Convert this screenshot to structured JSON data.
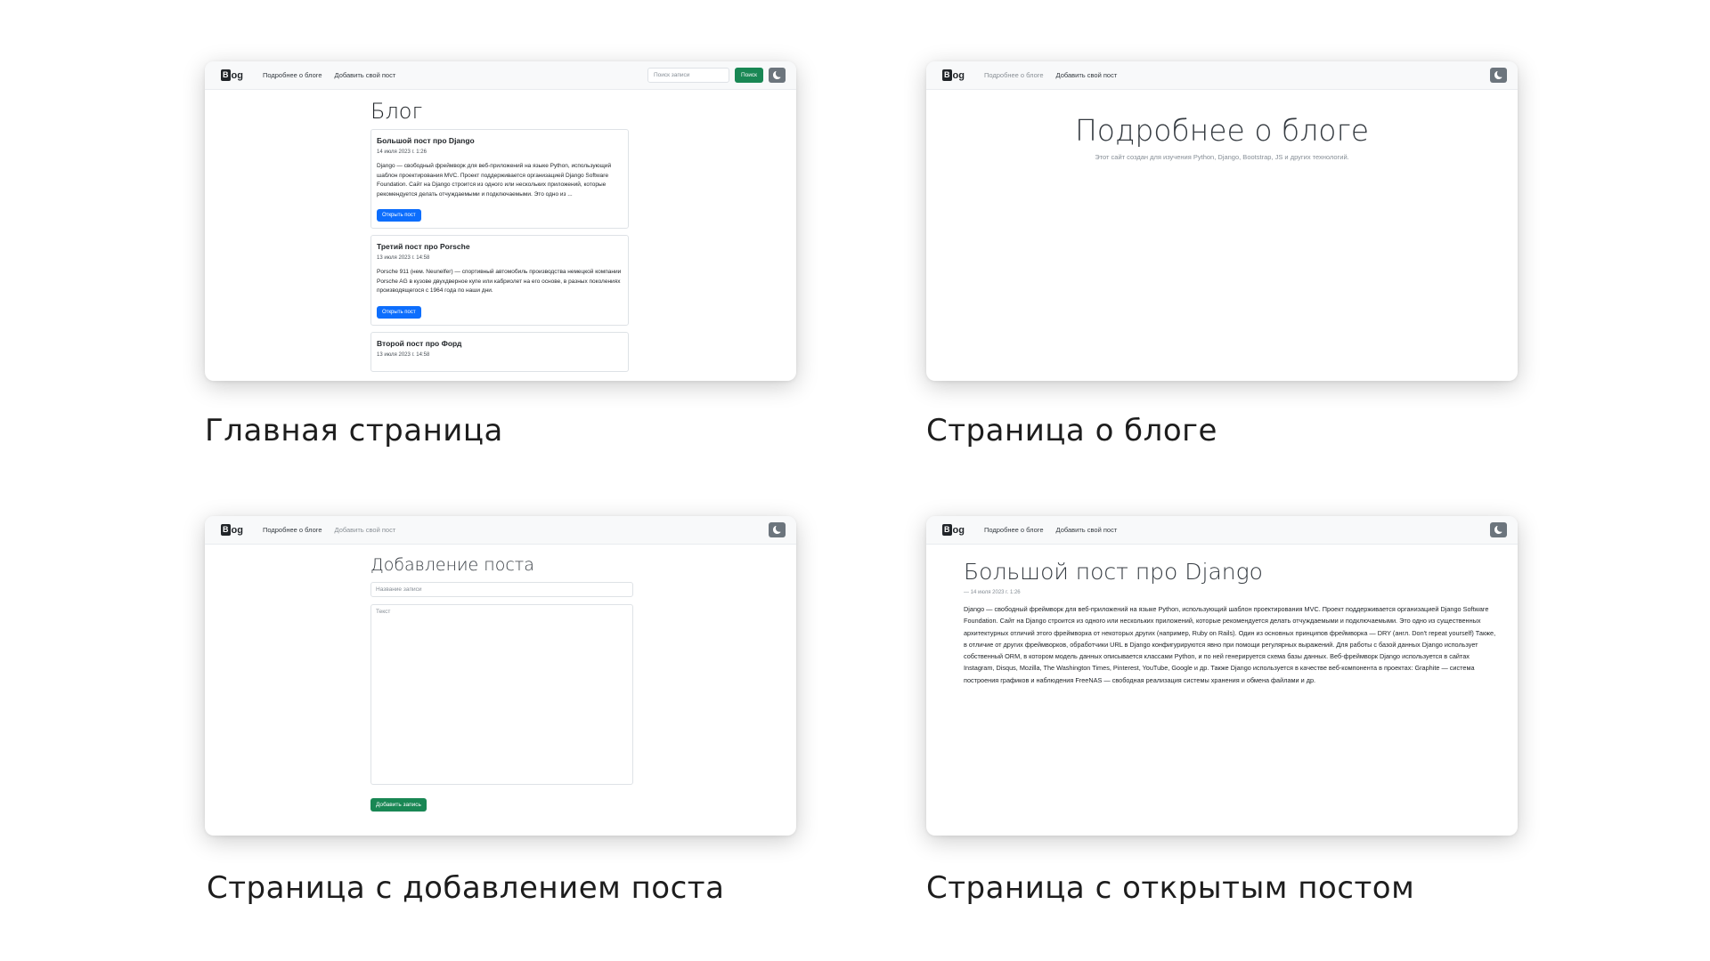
{
  "captions": {
    "home": "Главная страница",
    "about": "Страница о блоге",
    "add_post": "Страница с добавлением поста",
    "open_post": "Страница с открытым постом"
  },
  "nav": {
    "logo_letter": "B",
    "logo_rest": "og",
    "about_link": "Подробнее о блоге",
    "add_post_link": "Добавить свой пост",
    "search_placeholder": "Поиск записи",
    "search_button": "Поиск",
    "theme_icon": "moon-icon"
  },
  "home": {
    "title": "Блог",
    "posts": [
      {
        "title": "Большой пост про Django",
        "date": "14 июля 2023 г. 1:26",
        "text": "Django — свободный фреймворк для веб-приложений на языке Python, использующий шаблон проектирования MVC. Проект поддерживается организацией Django Software Foundation. Сайт на Django строится из одного или нескольких приложений, которые рекомендуется делать отчуждаемыми и подключаемыми. Это одно из ...",
        "button": "Открыть пост"
      },
      {
        "title": "Третий пост про Porsche",
        "date": "13 июля 2023 г. 14:58",
        "text": "Porsche 911 (нем. Neunelfer) — спортивный автомобиль производства немецкой компании Porsche AG в кузове двухдверное купе или кабриолет на его основе, в разных поколениях производящегося с 1964 года по наши дни.",
        "button": "Открыть пост"
      },
      {
        "title": "Второй пост про Форд",
        "date": "13 июля 2023 г. 14:58"
      }
    ]
  },
  "about": {
    "title": "Подробнее о блоге",
    "subtitle": "Этот сайт создан для изучения Python, Django, Bootstrap, JS и других технологий."
  },
  "add_post": {
    "title": "Добавление поста",
    "title_placeholder": "Название записи",
    "text_placeholder": "Текст",
    "submit": "Добавить запись"
  },
  "open_post": {
    "title": "Большой пост про Django",
    "date": "— 14 июля 2023 г. 1:26",
    "text": "Django — свободный фреймворк для веб-приложений на языке Python, использующий шаблон проектирования MVC. Проект поддерживается организацией Django Software Foundation. Сайт на Django строится из одного или нескольких приложений, которые рекомендуется делать отчуждаемыми и подключаемыми. Это одно из существенных архитектурных отличий этого фреймворка от некоторых других (например, Ruby on Rails). Один из основных принципов фреймворка — DRY (англ. Don't repeat yourself) Также, в отличие от других фреймворков, обработчики URL в Django конфигурируются явно при помощи регулярных выражений. Для работы с базой данных Django использует собственный ORM, в котором модель данных описывается классами Python, и по ней генерируется схема базы данных. Веб-фреймворк Django используется в сайтах Instagram, Disqus, Mozilla, The Washington Times, Pinterest, YouTube, Google и др. Также Django используется в качестве веб-компонента в проектах: Graphite — система построения графиков и наблюдения FreeNAS — свободная реализация системы хранения и обмена файлами и др."
  },
  "colors": {
    "primary": "#0d6efd",
    "success": "#198754",
    "secondary": "#6c757d",
    "navbar_bg": "#f8f9fa"
  }
}
